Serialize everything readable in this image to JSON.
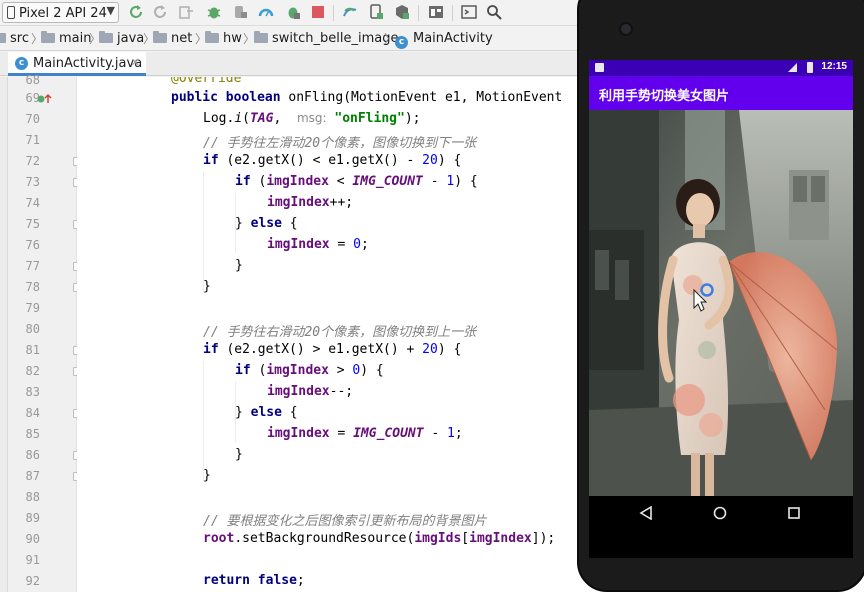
{
  "toolbar": {
    "device_label": "Pixel 2 API 24",
    "icons": [
      "run-icon",
      "apply-changes-icon",
      "apply-code-changes-icon",
      "debug-icon",
      "attach-debugger-icon",
      "profile-icon",
      "coverage-icon",
      "stop-icon",
      "gradle-sync-icon",
      "avd-manager-icon",
      "sdk-manager-icon",
      "project-structure-icon",
      "terminal-icon",
      "search-icon"
    ]
  },
  "breadcrumb": {
    "items": [
      "src",
      "main",
      "java",
      "net",
      "hw",
      "switch_belle_image",
      "MainActivity"
    ]
  },
  "tabs": {
    "active_file": "MainActivity.java"
  },
  "editor": {
    "lines": [
      {
        "no": "69",
        "text": "public boolean onFling(MotionEvent e1, MotionEvent"
      },
      {
        "no": "70",
        "text": "Log.i(TAG,  msg: \"onFling\");"
      },
      {
        "no": "71",
        "text": "// 手势往左滑动20个像素，图像切换到下一张"
      },
      {
        "no": "72",
        "text": "if (e2.getX() < e1.getX() - 20) {"
      },
      {
        "no": "73",
        "text": "if (imgIndex < IMG_COUNT - 1) {"
      },
      {
        "no": "74",
        "text": "imgIndex++;"
      },
      {
        "no": "75",
        "text": "} else {"
      },
      {
        "no": "76",
        "text": "imgIndex = 0;"
      },
      {
        "no": "77",
        "text": "}"
      },
      {
        "no": "78",
        "text": "}"
      },
      {
        "no": "79",
        "text": ""
      },
      {
        "no": "80",
        "text": "// 手势往右滑动20个像素，图像切换到上一张"
      },
      {
        "no": "81",
        "text": "if (e2.getX() > e1.getX() + 20) {"
      },
      {
        "no": "82",
        "text": "if (imgIndex > 0) {"
      },
      {
        "no": "83",
        "text": "imgIndex--;"
      },
      {
        "no": "84",
        "text": "} else {"
      },
      {
        "no": "85",
        "text": "imgIndex = IMG_COUNT - 1;"
      },
      {
        "no": "86",
        "text": "}"
      },
      {
        "no": "87",
        "text": "}"
      },
      {
        "no": "88",
        "text": ""
      },
      {
        "no": "89",
        "text": "// 要根据变化之后图像索引更新布局的背景图片"
      },
      {
        "no": "90",
        "text": "root.setBackgroundResource(imgIds[imgIndex]);"
      },
      {
        "no": "91",
        "text": ""
      },
      {
        "no": "92",
        "text": "return false;"
      }
    ],
    "partial_top_line": "@Override",
    "partial_top_line_no": "68"
  },
  "phone": {
    "status_time": "12:15",
    "app_title": "利用手势切换美女图片",
    "nav_icons": [
      "back-icon",
      "home-icon",
      "recents-icon"
    ]
  }
}
